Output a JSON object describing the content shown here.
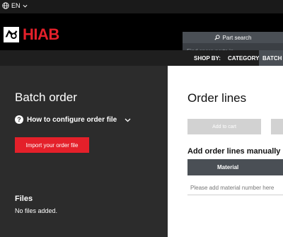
{
  "topbar": {
    "language": "EN",
    "globe_icon": "globe-icon",
    "chevron_icon": "chevron-down-icon"
  },
  "header": {
    "logo_text": "HIAB",
    "brand_color": "#e4202a",
    "search": {
      "button_label": "Part search",
      "placeholder": "Find spare parts in"
    }
  },
  "nav": {
    "shop_by": "SHOP BY:",
    "items": [
      "CATEGORY",
      "BATCH"
    ],
    "active": "BATCH"
  },
  "batch": {
    "title": "Batch order",
    "howto_label": "How to configure order file",
    "import_label": "Import your order file",
    "files_title": "Files",
    "files_empty": "No files added."
  },
  "order_lines": {
    "title": "Order lines",
    "add_to_cart": "Add to cart",
    "manual_title": "Add order lines manually",
    "material_header": "Material",
    "material_placeholder": "Please add material number here"
  }
}
